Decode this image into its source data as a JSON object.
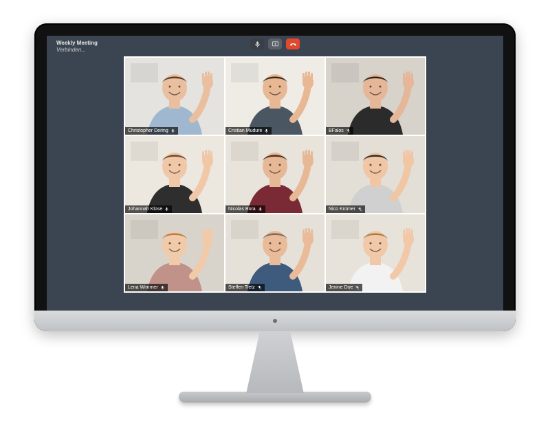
{
  "meeting": {
    "title": "Weekly Meeting",
    "status": "Verbinden..."
  },
  "controls": {
    "mic": "microphone",
    "share": "screen-share",
    "hangup": "hang-up"
  },
  "participants": [
    {
      "name": "Christopher Dering",
      "mic_on": true,
      "bg": "#e5e3df",
      "shirt": "#9fb8d0",
      "skin": "#e9bfa0",
      "hair": "#5a3b26"
    },
    {
      "name": "Cristian Mudure",
      "mic_on": true,
      "bg": "#efece6",
      "shirt": "#4a5662",
      "skin": "#e8b894",
      "hair": "#3b2a1c"
    },
    {
      "name": "BFalos",
      "mic_on": false,
      "bg": "#d7d2ca",
      "shirt": "#2b2b2b",
      "skin": "#e6b698",
      "hair": "#2a241e"
    },
    {
      "name": "Johannah Klose",
      "mic_on": true,
      "bg": "#ece7df",
      "shirt": "#2e2e2e",
      "skin": "#f0c8a8",
      "hair": "#6a4a30"
    },
    {
      "name": "Nicolas Bora",
      "mic_on": true,
      "bg": "#e9e4db",
      "shirt": "#7a2a34",
      "skin": "#e7b896",
      "hair": "#4a3220"
    },
    {
      "name": "Nico Kromer",
      "mic_on": false,
      "bg": "#e3ded6",
      "shirt": "#d0d0d0",
      "skin": "#f0c6a4",
      "hair": "#2b2b2b"
    },
    {
      "name": "Lena Wimmer",
      "mic_on": true,
      "bg": "#d9d4cb",
      "shirt": "#c0928a",
      "skin": "#f1caa9",
      "hair": "#b07e4a"
    },
    {
      "name": "Steffen Tietz",
      "mic_on": false,
      "bg": "#e6e1d8",
      "shirt": "#3e5a7d",
      "skin": "#e9bb98",
      "hair": "#7a6b5c"
    },
    {
      "name": "Jenine Doe",
      "mic_on": false,
      "bg": "#e8e3da",
      "shirt": "#f2f2f2",
      "skin": "#f1c9a8",
      "hair": "#a97b48"
    }
  ]
}
